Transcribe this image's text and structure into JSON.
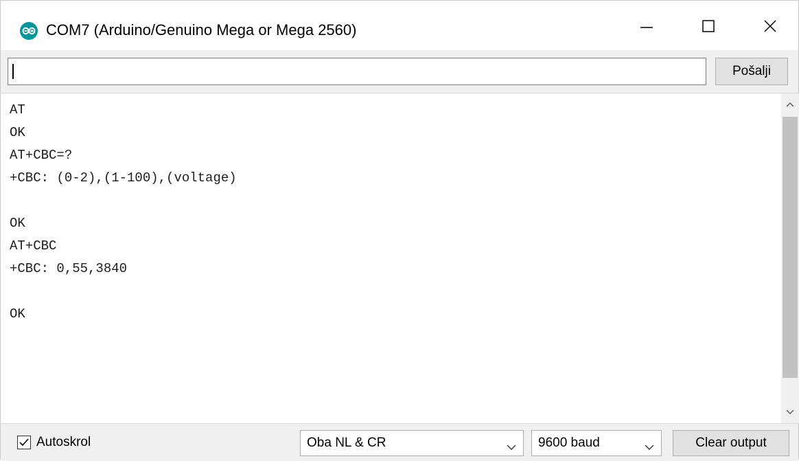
{
  "window": {
    "title": "COM7 (Arduino/Genuino Mega or Mega 2560)",
    "logo_icon": "arduino-logo-icon",
    "controls": {
      "minimize_icon": "minimize-icon",
      "maximize_icon": "maximize-icon",
      "close_icon": "close-icon"
    }
  },
  "send": {
    "input_value": "",
    "button_label": "Pošalji"
  },
  "output": {
    "lines": [
      "AT",
      "OK",
      "AT+CBC=?",
      "+CBC: (0-2),(1-100),(voltage)",
      "",
      "OK",
      "AT+CBC",
      "+CBC: 0,55,3840",
      "",
      "OK"
    ]
  },
  "footer": {
    "autoscroll_label": "Autoskrol",
    "autoscroll_checked": true,
    "line_ending_value": "Oba NL & CR",
    "baud_value": "9600 baud",
    "clear_label": "Clear output"
  },
  "colors": {
    "logo": "#00979c",
    "chrome_bg": "#f0f0f0",
    "button_bg": "#e1e1e1",
    "scroll_thumb": "#c1c1c1"
  }
}
